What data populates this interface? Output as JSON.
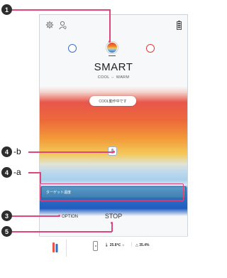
{
  "header": {
    "icons": {
      "settings": "gear-icon",
      "user": "user-icon",
      "battery": "battery-icon"
    }
  },
  "modes": {
    "title": "SMART",
    "subtitle": "COOL ⇔ WARM",
    "cool_color": "#3a6fd0",
    "warm_color": "#e03a3a"
  },
  "status": {
    "label": "COOL動作中です"
  },
  "target": {
    "label": "ターゲット温度"
  },
  "controls": {
    "option_label": "OPTION",
    "stop_label": "STOP"
  },
  "footer": {
    "temperature": "25.8℃",
    "humidity": "35.4%"
  },
  "callouts": {
    "c1": "1",
    "c4b": "4",
    "c4b_suffix": "-b",
    "c4a": "4",
    "c4a_suffix": "-a",
    "c3": "3",
    "c5": "5"
  },
  "accent_color": "#e0457b"
}
